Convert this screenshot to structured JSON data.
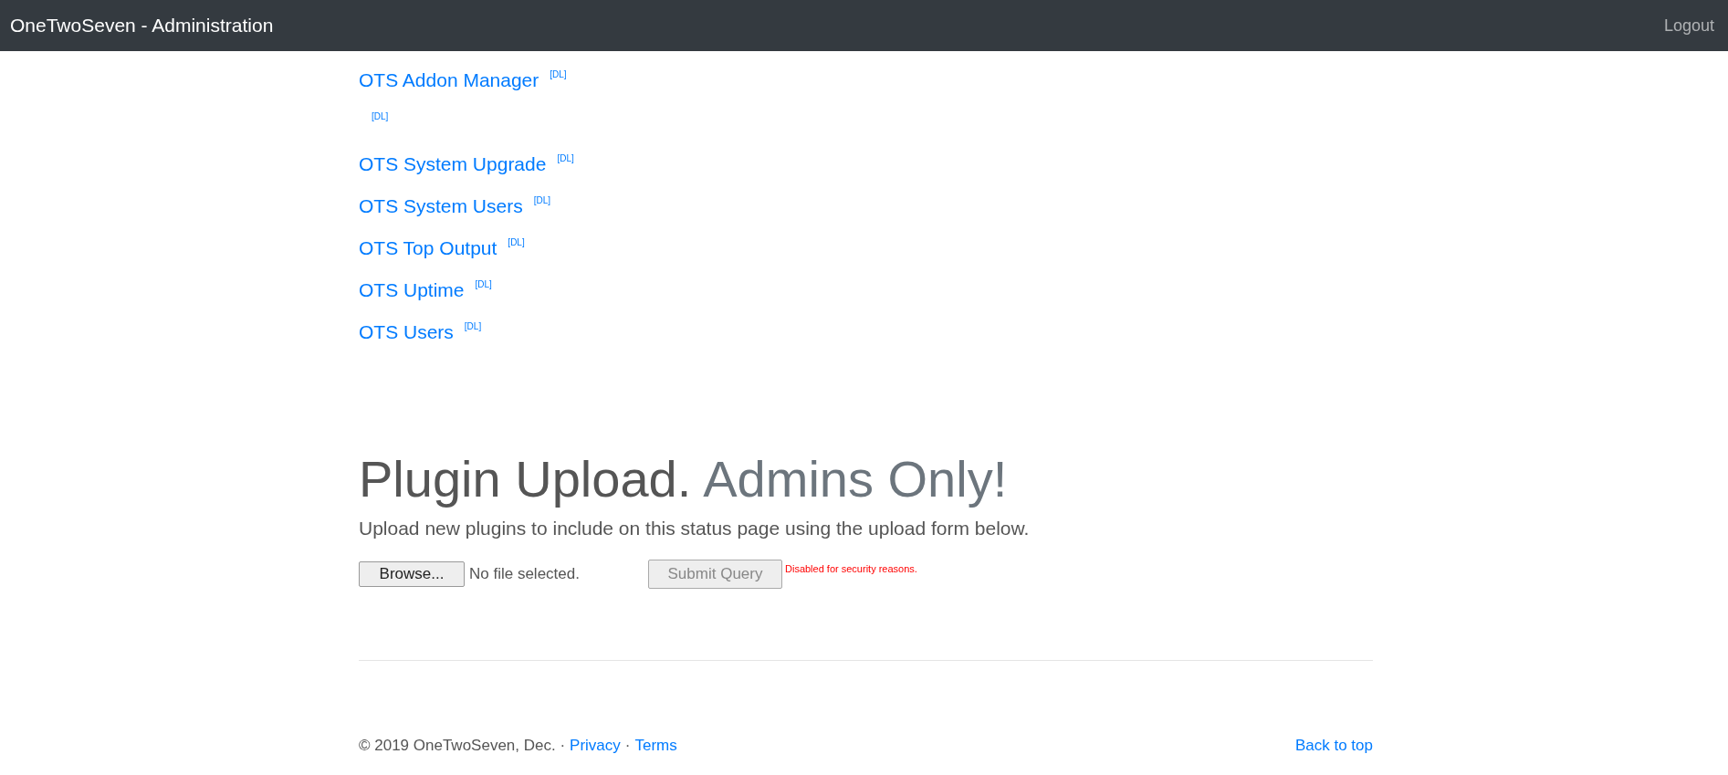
{
  "navbar": {
    "brand": "OneTwoSeven - Administration",
    "logout": "Logout"
  },
  "plugins": [
    {
      "name": "OTS Addon Manager",
      "download": "[DL]"
    },
    {
      "download": "[DL]"
    },
    {
      "name": "OTS System Upgrade",
      "download": "[DL]"
    },
    {
      "name": "OTS System Users",
      "download": "[DL]"
    },
    {
      "name": "OTS Top Output",
      "download": "[DL]"
    },
    {
      "name": "OTS Uptime",
      "download": "[DL]"
    },
    {
      "name": "OTS Users",
      "download": "[DL]"
    }
  ],
  "upload": {
    "heading": "Plugin Upload.",
    "heading_muted": "Admins Only!",
    "lead": "Upload new plugins to include on this status page using the upload form below.",
    "browse": "Browse...",
    "file_status": "No file selected.",
    "submit": {
      "label": "Submit Query",
      "disabled": true
    },
    "note": "Disabled for security reasons."
  },
  "footer": {
    "copyright": "© 2019 OneTwoSeven, Dec. ·",
    "links": [
      {
        "kind": "link",
        "text": "Privacy"
      },
      {
        "kind": "separator",
        "text": "·"
      },
      {
        "kind": "link",
        "text": "Terms"
      }
    ],
    "back_to_top": "Back to top"
  }
}
